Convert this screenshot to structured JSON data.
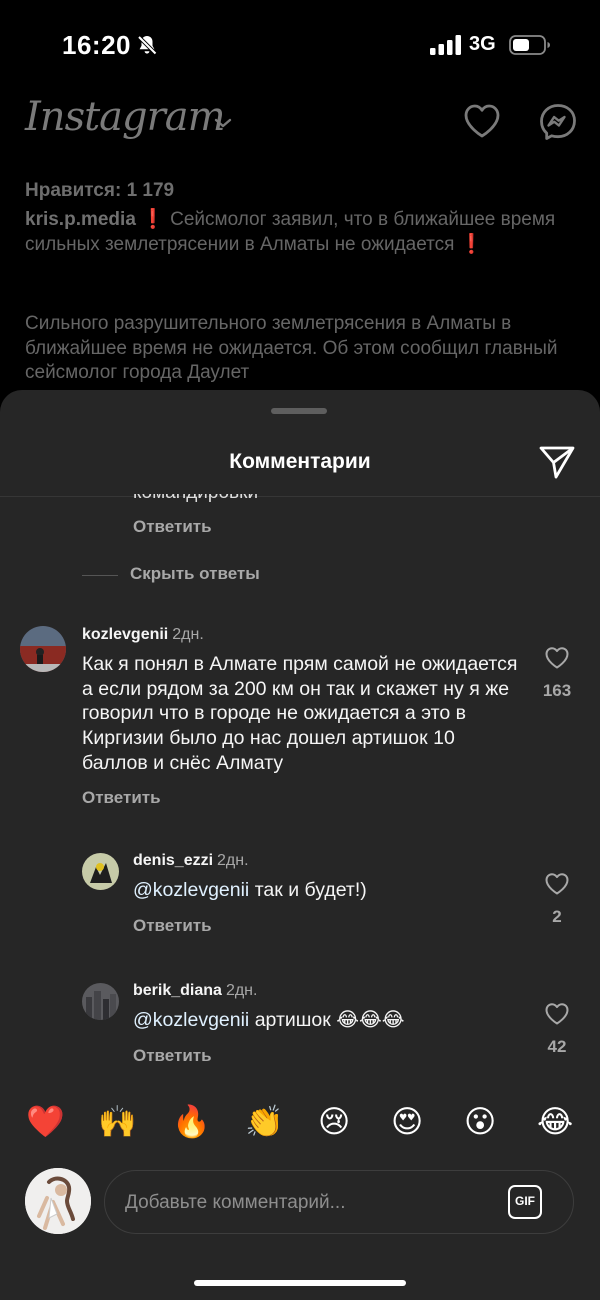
{
  "status_bar": {
    "time": "16:20",
    "network": "3G"
  },
  "header": {
    "logo": "Instagram",
    "icons": [
      "chevron-down-icon",
      "heart-icon",
      "messenger-icon"
    ]
  },
  "post": {
    "likes": "Нравится: 1 179",
    "author": "kris.p.media",
    "caption_icon": "❗",
    "caption": "Сейсмолог заявил, что в ближайшее время сильных землетрясении в Алматы не ожидается",
    "caption_end_icon": "❗",
    "body": "Сильного разрушительного землетрясения в Алматы в ближайшее время не ожидается. Об этом сообщил главный сейсмолог города Даулет"
  },
  "comments_sheet": {
    "title": "Комментарии",
    "cut_off_text": "командировки",
    "reply_label": "Ответить",
    "hide_replies": "Скрыть ответы",
    "comments": [
      {
        "username": "kozlevgenii",
        "age": "2дн.",
        "text": "Как я понял в Алмате прям самой не ожидается а если рядом за 200 км он так и скажет ну я же говорил что в городе не ожидается а это в Киргизии было до нас дошел артишок 10 баллов и снёс Алмату",
        "likes": "163"
      },
      {
        "username": "denis_ezzi",
        "age": "2дн.",
        "mention": "@kozlevgenii",
        "text": " так и будет!)",
        "likes": "2"
      },
      {
        "username": "berik_diana",
        "age": "2дн.",
        "mention": "@kozlevgenii",
        "text": " артишок 😂😂😂",
        "likes": "42"
      }
    ]
  },
  "emoji_bar": [
    "❤️",
    "🙌",
    "🔥",
    "👏",
    "😢",
    "😍",
    "😮",
    "😂"
  ],
  "input": {
    "placeholder": "Добавьте комментарий...",
    "gif_label": "GIF"
  }
}
